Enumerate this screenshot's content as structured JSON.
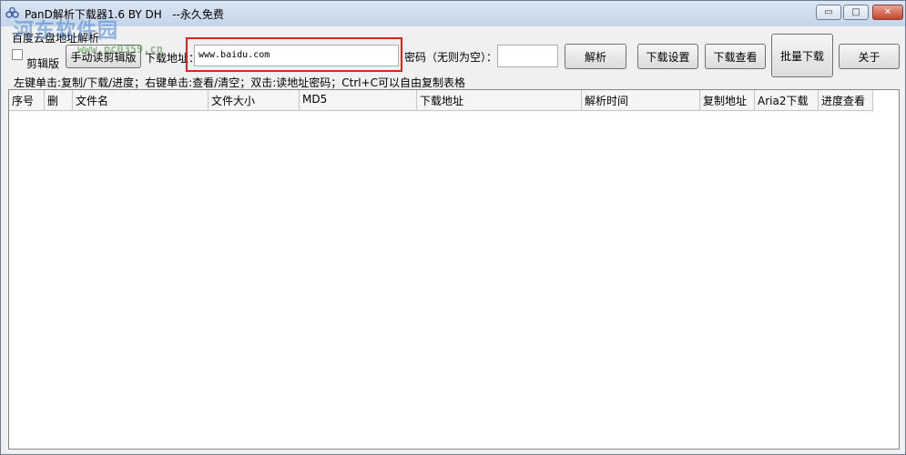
{
  "window": {
    "title": "PanD解析下载器1.6 BY DH   --永久免费",
    "controls": {
      "minimize": "▭",
      "maximize": "□",
      "close": "✕"
    }
  },
  "watermark": {
    "main": "河东软件园",
    "sub": "www.pc0359.cn"
  },
  "group": {
    "label": "百度云盘地址解析",
    "clipboard_checkbox": {
      "label": "剪辑版",
      "checked": false
    }
  },
  "toolbar": {
    "read_clipboard_button": "手动读剪辑版",
    "url_label": "下载地址：",
    "url_value": "www.baidu.com",
    "password_label": "密码（无则为空）：",
    "password_value": "",
    "parse_button": "解析",
    "download_settings_button": "下载设置",
    "download_view_button": "下载查看",
    "batch_download_button": "批量下载",
    "about_button": "关于"
  },
  "hint": "左键单击:复制/下载/进度；右键单击:查看/清空；双击:读地址密码；Ctrl+C可以自由复制表格",
  "table": {
    "columns": [
      "序号",
      "删",
      "文件名",
      "文件大小",
      "MD5",
      "下载地址",
      "解析时间",
      "复制地址",
      "Aria2下载",
      "进度查看"
    ],
    "rows": []
  },
  "colors": {
    "highlight": "#e0211d",
    "titlebar": "#c4d4e8",
    "watermark": "#4682d2"
  }
}
